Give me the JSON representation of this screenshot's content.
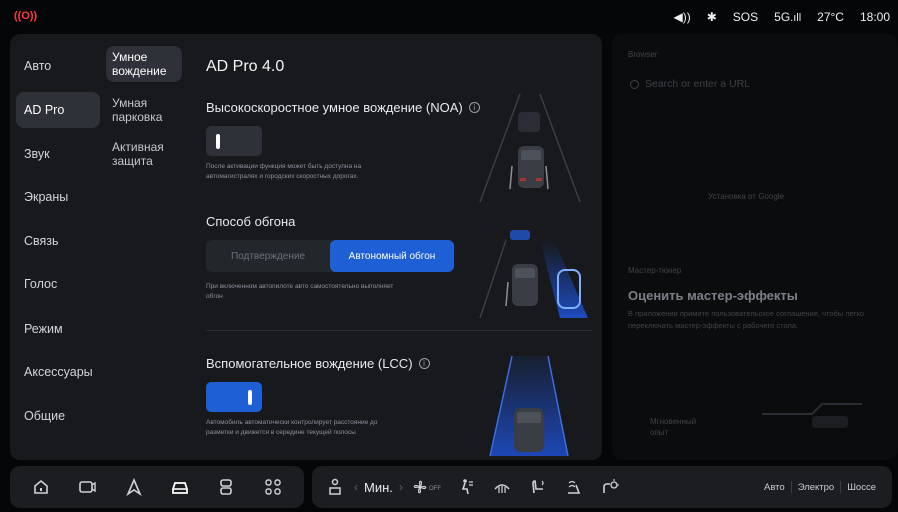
{
  "status": {
    "sos": "SOS",
    "network": "5G",
    "temperature": "27°C",
    "time": "18:00"
  },
  "nav": {
    "items": [
      {
        "label": "Авто"
      },
      {
        "label": "AD Pro"
      },
      {
        "label": "Звук"
      },
      {
        "label": "Экраны"
      },
      {
        "label": "Связь"
      },
      {
        "label": "Голос"
      },
      {
        "label": "Режим"
      },
      {
        "label": "Аксессуары"
      },
      {
        "label": "Общие"
      }
    ],
    "active": "AD Pro"
  },
  "subnav": {
    "items": [
      {
        "label": "Умное вождение"
      },
      {
        "label": "Умная парковка"
      },
      {
        "label": "Активная защита"
      }
    ]
  },
  "content": {
    "title": "AD Pro 4.0",
    "noa": {
      "title": "Высокоскоростное умное вождение (NOA)",
      "enabled": false,
      "desc": "После активации функция может быть доступна на автомагистралях и городских скоростных дорогах."
    },
    "overtake": {
      "title": "Способ обгона",
      "options": [
        "Подтверждение",
        "Автономный обгон"
      ],
      "selected": "Автономный обгон",
      "desc": "При включенном автопилоте авто самостоятельно выполняет обгон"
    },
    "lcc": {
      "title": "Вспомогательное вождение (LCC)",
      "enabled": true,
      "desc": "Автомобиль автоматически контролирует расстояние до разметки и движется в середине текущей полосы"
    }
  },
  "right_panel": {
    "browser_label": "Browser",
    "search_placeholder": "Search or enter a URL",
    "middle_text": "Установка от Google",
    "tuner_label": "Мастер-тюнер",
    "tuner_title": "Оценить мастер-эффекты",
    "tuner_desc": "В приложении примите пользовательское соглашение, чтобы легко переключать мастер-эффекты с рабочего стола.",
    "instant_label": "Мгновенный опыт"
  },
  "dock": {
    "temp_label": "Мин.",
    "fan_state": "OFF",
    "modes": [
      "Авто",
      "Электро",
      "Шоссе"
    ]
  },
  "colors": {
    "accent": "#1f5fd6",
    "alert": "#ff3b3b",
    "panel": "#17191d"
  }
}
